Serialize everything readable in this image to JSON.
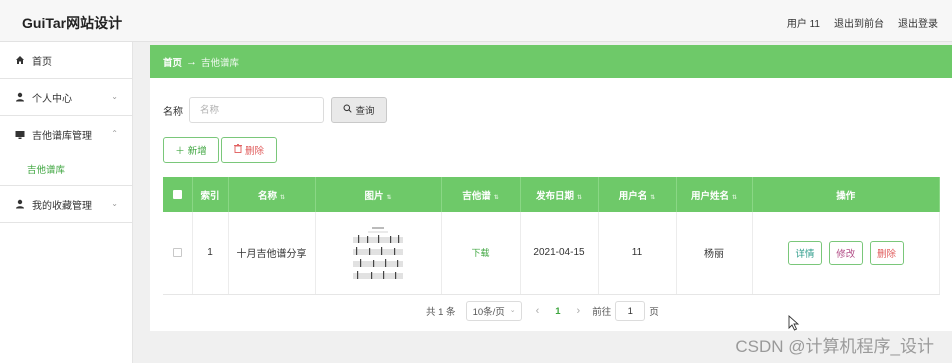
{
  "header": {
    "title": "GuiTar网站设计",
    "user_label": "用户 11",
    "back_to_front": "退出到前台",
    "logout": "退出登录"
  },
  "sidebar": {
    "items": [
      {
        "label": "首页",
        "icon": "home-icon"
      },
      {
        "label": "个人中心",
        "icon": "user-icon"
      },
      {
        "label": "吉他谱库管理",
        "icon": "monitor-icon"
      },
      {
        "label": "我的收藏管理",
        "icon": "user-icon"
      }
    ],
    "sub_item": "吉他谱库"
  },
  "breadcrumb": {
    "home": "首页",
    "arrow": "→",
    "current": "吉他谱库"
  },
  "search": {
    "label": "名称",
    "placeholder": "名称",
    "button": "查询"
  },
  "actions": {
    "add": "新增",
    "delete": "删除"
  },
  "table": {
    "headers": [
      "索引",
      "名称",
      "图片",
      "吉他谱",
      "发布日期",
      "用户名",
      "用户姓名",
      "操作"
    ],
    "rows": [
      {
        "index": "1",
        "name": "十月吉他谱分享",
        "download": "下载",
        "date": "2021-04-15",
        "username": "11",
        "realname": "杨丽",
        "ops": [
          "详情",
          "修改",
          "删除"
        ]
      }
    ]
  },
  "pagination": {
    "total": "共 1 条",
    "page_size": "10条/页",
    "current_page": "1",
    "goto_label": "前往",
    "goto_value": "1",
    "page_suffix": "页"
  },
  "watermark": "CSDN @计算机程序_设计",
  "colors": {
    "primary": "#6ec969",
    "active_text": "#3fa640",
    "danger": "#e05a5a"
  }
}
